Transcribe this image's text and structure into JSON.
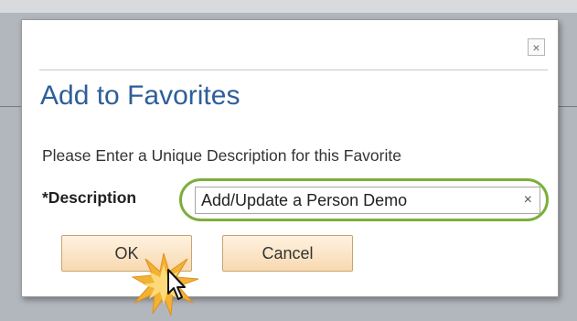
{
  "dialog": {
    "title": "Add to Favorites",
    "close_icon": "close-icon",
    "instruction": "Please Enter a Unique Description for this Favorite",
    "description_label": "*Description",
    "description_value": "Add/Update a Person Demo",
    "clear_icon": "clear-icon",
    "clear_glyph": "×",
    "close_glyph": "×",
    "ok_label": "OK",
    "cancel_label": "Cancel"
  },
  "colors": {
    "title": "#2e5e9a",
    "highlight_ring": "#7cae3e",
    "button_fill": "#f8d9b0",
    "click_burst": "#f2b233"
  },
  "overlay": {
    "pointer_icon": "mouse-pointer-icon",
    "click_effect_icon": "click-burst-icon"
  }
}
